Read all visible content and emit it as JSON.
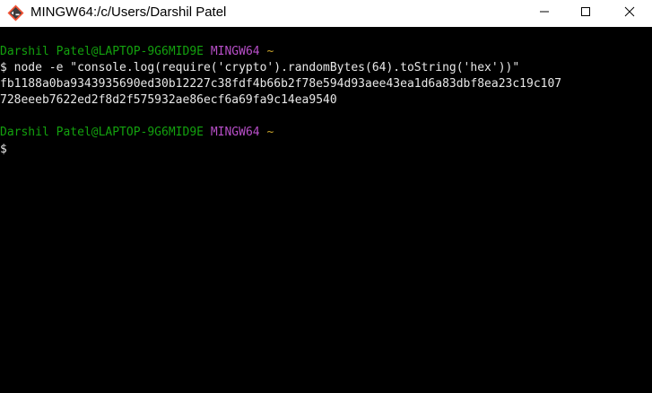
{
  "window": {
    "title": "MINGW64:/c/Users/Darshil Patel",
    "icon": "git-bash-icon",
    "controls": {
      "minimize": "minimize-icon",
      "maximize": "maximize-icon",
      "close": "close-icon"
    }
  },
  "terminal": {
    "colors": {
      "background": "#000000",
      "user_host": "#13a10e",
      "shell": "#b84fc9",
      "path": "#c8a32a",
      "text": "#e8e8e8"
    },
    "prompt1": {
      "user_host": "Darshil Patel@LAPTOP-9G6MID9E",
      "shell": "MINGW64",
      "path": "~"
    },
    "command1": "$ node -e \"console.log(require('crypto').randomBytes(64).toString('hex'))\"",
    "output1": "fb1188a0ba9343935690ed30b12227c38fdf4b66b2f78e594d93aee43ea1d6a83dbf8ea23c19c107",
    "output2": "728eeeb7622ed2f8d2f575932ae86ecf6a69fa9c14ea9540",
    "prompt2": {
      "user_host": "Darshil Patel@LAPTOP-9G6MID9E",
      "shell": "MINGW64",
      "path": "~"
    },
    "command2": "$"
  }
}
